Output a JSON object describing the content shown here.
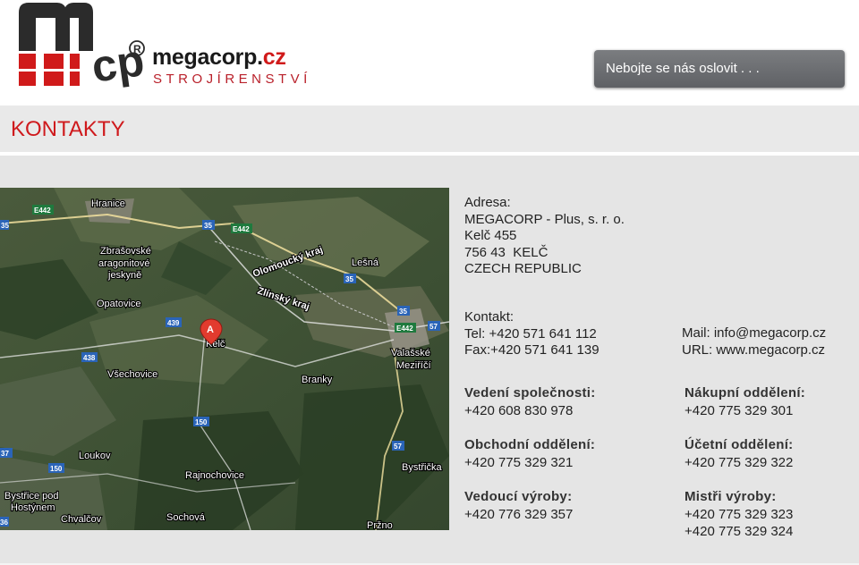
{
  "header": {
    "brand_main": "megacorp.",
    "brand_tld": "cz",
    "brand_sub": "STROJÍRENSTVÍ",
    "logo_letters": "mcp",
    "slogan": "Nebojte se nás oslovit . . .",
    "colors": {
      "brand_red": "#cf1a1d",
      "logo_dark": "#2b2b2b",
      "slogan_bg": "#6c6e72"
    }
  },
  "page_title": "KONTAKTY",
  "map": {
    "labels": [
      "Hranice",
      "Zbrašovské",
      "aragonitové",
      "jeskyně",
      "Olomoucký kraj",
      "Zlínský kraj",
      "Lešná",
      "Opatovice",
      "Kelč",
      "Valašské",
      "Meziříčí",
      "Všechovice",
      "Branky",
      "Loukov",
      "Rajnochovice",
      "Bystřička",
      "Bystřice pod",
      "Hostýnem",
      "Chvalčov",
      "Sochová",
      "Pržno"
    ],
    "road_numbers": [
      "E442",
      "35",
      "35",
      "E442",
      "35",
      "35",
      "439",
      "438",
      "E442",
      "57",
      "150",
      "57",
      "37",
      "150",
      "36"
    ],
    "marker_letter": "A"
  },
  "address": {
    "heading": "Adresa:",
    "lines": [
      "MEGACORP - Plus, s. r. o.",
      "Kelč 455",
      "756 43  KELČ",
      "CZECH REPUBLIC"
    ]
  },
  "contact": {
    "heading": "Kontakt:",
    "tel": "Tel: +420 571 641 112",
    "fax": "Fax:+420 571 641 139",
    "mail": "Mail: info@megacorp.cz",
    "url": "URL: www.megacorp.cz"
  },
  "departments": [
    {
      "label": "Vedení společnosti:",
      "phones": [
        "+420 608 830 978"
      ]
    },
    {
      "label": "Nákupní oddělení:",
      "phones": [
        "+420 775 329 301"
      ]
    },
    {
      "label": "Obchodní oddělení:",
      "phones": [
        "+420 775 329 321"
      ]
    },
    {
      "label": "Účetní oddělení:",
      "phones": [
        "+420 775 329 322"
      ]
    },
    {
      "label": "Vedoucí výroby:",
      "phones": [
        "+420 776 329 357"
      ]
    },
    {
      "label": "Mistři výroby:",
      "phones": [
        "+420 775 329 323",
        "+420 775 329 324"
      ]
    }
  ]
}
